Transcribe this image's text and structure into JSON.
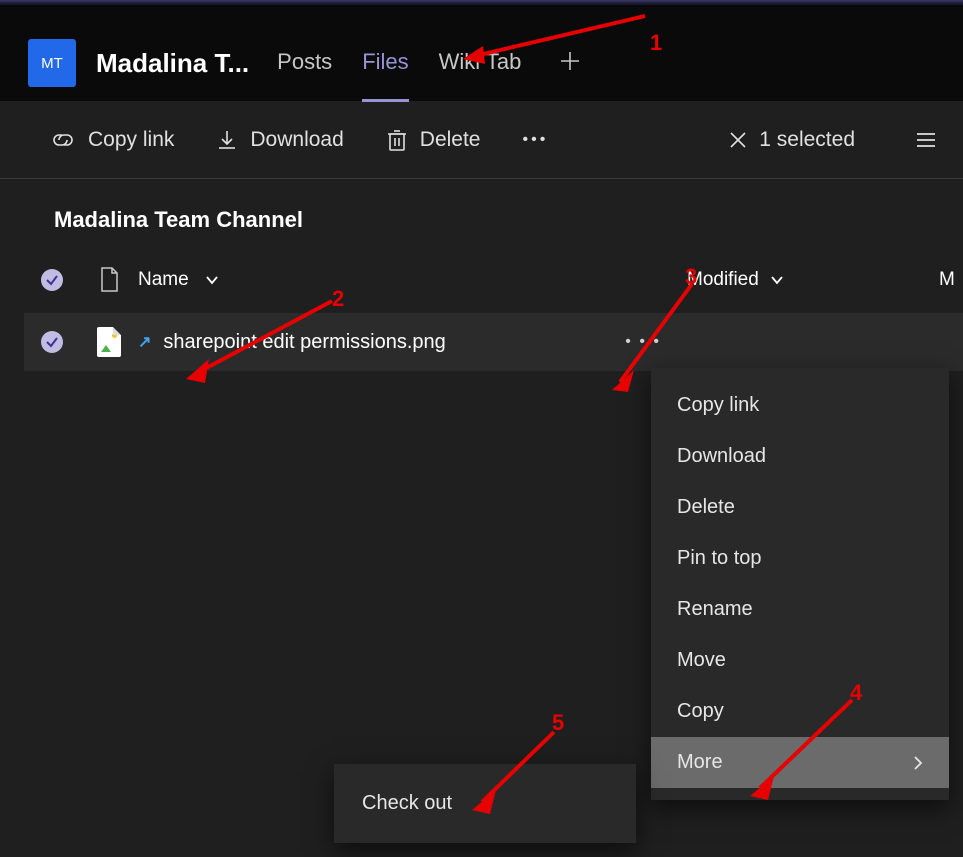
{
  "header": {
    "badge": "MT",
    "title": "Madalina T...",
    "tabs": {
      "posts": "Posts",
      "files": "Files",
      "wiki": "Wiki Tab"
    }
  },
  "toolbar": {
    "copy_link": "Copy link",
    "download": "Download",
    "delete": "Delete",
    "selected": "1 selected"
  },
  "breadcrumb": "Madalina Team Channel",
  "columns": {
    "name": "Name",
    "modified": "Modified",
    "modified_by": "M"
  },
  "files": [
    {
      "name": "sharepoint edit permissions.png"
    }
  ],
  "context_menu": {
    "copy_link": "Copy link",
    "download": "Download",
    "delete": "Delete",
    "pin": "Pin to top",
    "rename": "Rename",
    "move": "Move",
    "copy": "Copy",
    "more": "More"
  },
  "submenu": {
    "check_out": "Check out"
  },
  "annotations": {
    "a1": "1",
    "a2": "2",
    "a3": "3",
    "a4": "4",
    "a5": "5"
  }
}
